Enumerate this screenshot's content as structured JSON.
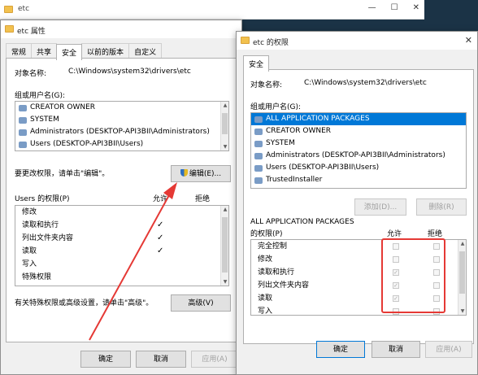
{
  "explorer": {
    "title": "etc"
  },
  "props_dialog": {
    "title": "etc 属性",
    "tabs": [
      "常规",
      "共享",
      "安全",
      "以前的版本",
      "自定义"
    ],
    "object_label": "对象名称:",
    "object_path": "C:\\Windows\\system32\\drivers\\etc",
    "group_label": "组或用户名(G):",
    "users": [
      "CREATOR OWNER",
      "SYSTEM",
      "Administrators (DESKTOP-API3BII\\Administrators)",
      "Users (DESKTOP-API3BII\\Users)"
    ],
    "change_hint": "要更改权限，请单击\"编辑\"。",
    "edit_button": "编辑(E)...",
    "perms_label": "Users 的权限(P)",
    "allow_header": "允许",
    "deny_header": "拒绝",
    "permissions": [
      {
        "name": "修改",
        "allow": false
      },
      {
        "name": "读取和执行",
        "allow": true
      },
      {
        "name": "列出文件夹内容",
        "allow": true
      },
      {
        "name": "读取",
        "allow": true
      },
      {
        "name": "写入",
        "allow": false
      },
      {
        "name": "特殊权限",
        "allow": false
      }
    ],
    "special_hint": "有关特殊权限或高级设置，请单击\"高级\"。",
    "advanced_button": "高级(V)",
    "ok": "确定",
    "cancel": "取消",
    "apply": "应用(A)"
  },
  "perm_dialog": {
    "title": "etc 的权限",
    "tab": "安全",
    "object_label": "对象名称:",
    "object_path": "C:\\Windows\\system32\\drivers\\etc",
    "group_label": "组或用户名(G):",
    "users": [
      "ALL APPLICATION PACKAGES",
      "CREATOR OWNER",
      "SYSTEM",
      "Administrators (DESKTOP-API3BII\\Administrators)",
      "Users (DESKTOP-API3BII\\Users)",
      "TrustedInstaller"
    ],
    "add_button": "添加(D)...",
    "remove_button": "删除(R)",
    "perms_label_1": "ALL APPLICATION PACKAGES",
    "perms_label_2": "的权限(P)",
    "allow_header": "允许",
    "deny_header": "拒绝",
    "permissions": [
      {
        "name": "完全控制",
        "allow": false
      },
      {
        "name": "修改",
        "allow": false
      },
      {
        "name": "读取和执行",
        "allow": true
      },
      {
        "name": "列出文件夹内容",
        "allow": true
      },
      {
        "name": "读取",
        "allow": true
      },
      {
        "name": "写入",
        "allow": false
      }
    ],
    "ok": "确定",
    "cancel": "取消",
    "apply": "应用(A)"
  },
  "colors": {
    "selection": "#0078d7",
    "annotation": "#e53935"
  }
}
